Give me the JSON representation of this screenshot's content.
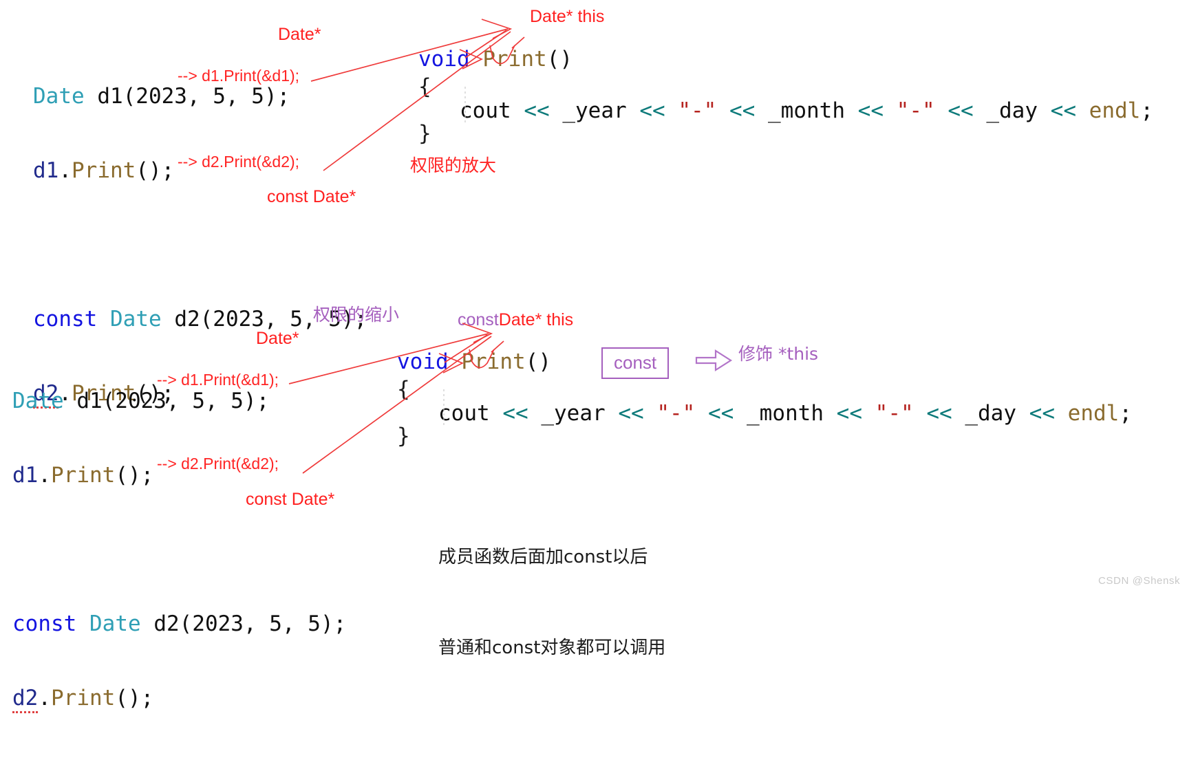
{
  "watermark": "CSDN @Shensk",
  "top": {
    "code": {
      "line1": {
        "type": "Date",
        "rest": " d1(2023, 5, 5);",
        "var": "d1"
      },
      "line2": {
        "var": "d1",
        "dot": ".",
        "fn": "Print",
        "rest": "();"
      },
      "line3": {
        "kw": "const",
        "type": "Date",
        "var": "d2",
        "rest": " d2(2023, 5, 5);"
      },
      "line4": {
        "var": "d2",
        "dot": ".",
        "fn": "Print",
        "rest": "();"
      }
    },
    "annotations": {
      "date_star_1": "Date*",
      "call1": "--> d1.Print(&d1);",
      "call2": "--> d2.Print(&d2);",
      "const_date_star": "const Date*",
      "this_label": "Date* this",
      "permission_note": "权限的放大"
    },
    "func": {
      "ret": "void",
      "name": "Print",
      "parens": "()",
      "open": "{",
      "close": "}",
      "body": {
        "cout": "cout",
        "op": "<<",
        "year": "_year",
        "dash": "\"-\"",
        "month": "_month",
        "day": "_day",
        "endl": "endl",
        "semi": ";"
      }
    }
  },
  "bottom": {
    "code": {
      "line1": {
        "type": "Date",
        "rest": " d1(2023, 5, 5);",
        "var": "d1"
      },
      "line2": {
        "var": "d1",
        "dot": ".",
        "fn": "Print",
        "rest": "();"
      },
      "line3": {
        "kw": "const",
        "type": "Date",
        "var": "d2",
        "rest": " d2(2023, 5, 5);"
      },
      "line4": {
        "var": "d2",
        "dot": ".",
        "fn": "Print",
        "rest": "();"
      }
    },
    "annotations": {
      "date_star_1": "Date*",
      "call1": "--> d1.Print(&d1);",
      "call2": "--> d2.Print(&d2);",
      "const_date_star": "const Date*",
      "this_const": "const",
      "this_label": "Date* this",
      "permission_note": "权限的缩小",
      "const_box": "const",
      "modify_note": "修饰 *this"
    },
    "func": {
      "ret": "void",
      "name": "Print",
      "parens": "()",
      "open": "{",
      "close": "}",
      "body": {
        "cout": "cout",
        "op": "<<",
        "year": "_year",
        "dash": "\"-\"",
        "month": "_month",
        "day": "_day",
        "endl": "endl",
        "semi": ";"
      }
    },
    "summary": {
      "line1": "成员函数后面加const以后",
      "line2": "普通和const对象都可以调用"
    }
  },
  "colors": {
    "red": "#ff2020",
    "purple": "#a55fbe",
    "type_teal": "#2f9fb5",
    "keyword_blue": "#1414e0",
    "fn_olive": "#8a6b2e",
    "op_teal": "#0d7a7a",
    "string_red": "#b5231f"
  }
}
